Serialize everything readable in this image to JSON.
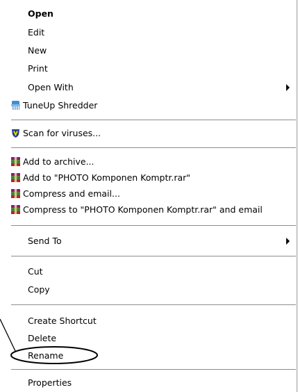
{
  "context_menu": {
    "items": [
      {
        "label": "Open",
        "bold": true
      },
      {
        "label": "Edit"
      },
      {
        "label": "New"
      },
      {
        "label": "Print"
      },
      {
        "label": "Open With",
        "submenu": true
      },
      {
        "label": "TuneUp Shredder",
        "icon": "tuneup-shredder-icon"
      },
      {
        "label": "Scan for viruses...",
        "icon": "antivirus-shield-icon"
      },
      {
        "label": "Add to archive...",
        "icon": "winrar-icon"
      },
      {
        "label": "Add to \"PHOTO Komponen Komptr.rar\"",
        "icon": "winrar-icon"
      },
      {
        "label": "Compress and email...",
        "icon": "winrar-icon"
      },
      {
        "label": "Compress to \"PHOTO Komponen Komptr.rar\" and email",
        "icon": "winrar-icon"
      },
      {
        "label": "Send To",
        "submenu": true
      },
      {
        "label": "Cut"
      },
      {
        "label": "Copy"
      },
      {
        "label": "Create Shortcut"
      },
      {
        "label": "Delete"
      },
      {
        "label": "Rename",
        "highlighted_by_callout": true
      },
      {
        "label": "Properties"
      }
    ]
  },
  "colors": {
    "separator": "#8c8c8c",
    "menu_background": "#ffffff",
    "text": "#000000",
    "winrar_red": "#b0203a",
    "winrar_green": "#2d8f2d",
    "shield_blue": "#1c3f95",
    "tuneup_blue": "#3c8fd6"
  }
}
